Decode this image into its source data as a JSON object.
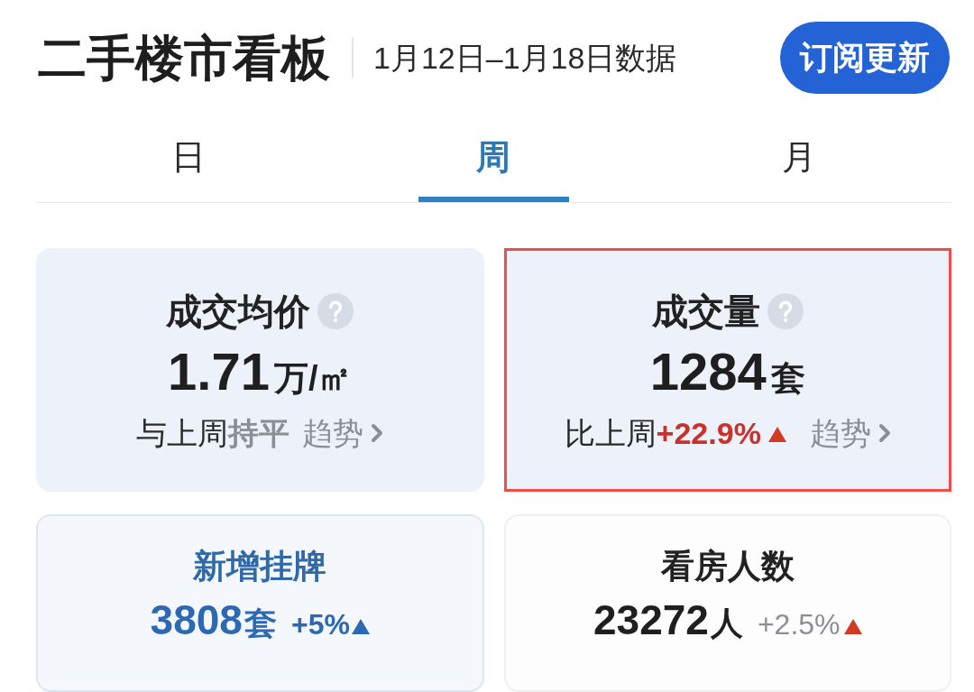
{
  "header": {
    "title": "二手楼市看板",
    "date_range": "1月12日–1月18日数据",
    "subscribe_button": "订阅更新"
  },
  "tabs": [
    {
      "label": "日",
      "selected": false
    },
    {
      "label": "周",
      "selected": true
    },
    {
      "label": "月",
      "selected": false
    }
  ],
  "cards": [
    {
      "kind": "summary",
      "title": "成交均价",
      "help": true,
      "value": "1.71",
      "unit": "万/㎡",
      "comparison": "与上周",
      "change": "持平",
      "rising": false,
      "trend_link": "趋势",
      "highlighted": false
    },
    {
      "kind": "summary",
      "title": "成交量",
      "help": true,
      "value": "1284",
      "unit": "套",
      "comparison": "比上周",
      "change": "+22.9%",
      "rising": true,
      "trend_link": "趋势",
      "highlighted": true
    },
    {
      "kind": "accent",
      "title": "新增挂牌",
      "help": false,
      "value": "3808",
      "unit": "套",
      "change": "+5%",
      "rising": true,
      "highlighted": false
    },
    {
      "kind": "plain",
      "title": "看房人数",
      "help": false,
      "value": "23272",
      "unit": "人",
      "change": "+2.5%",
      "rising": true,
      "highlighted": false
    }
  ]
}
